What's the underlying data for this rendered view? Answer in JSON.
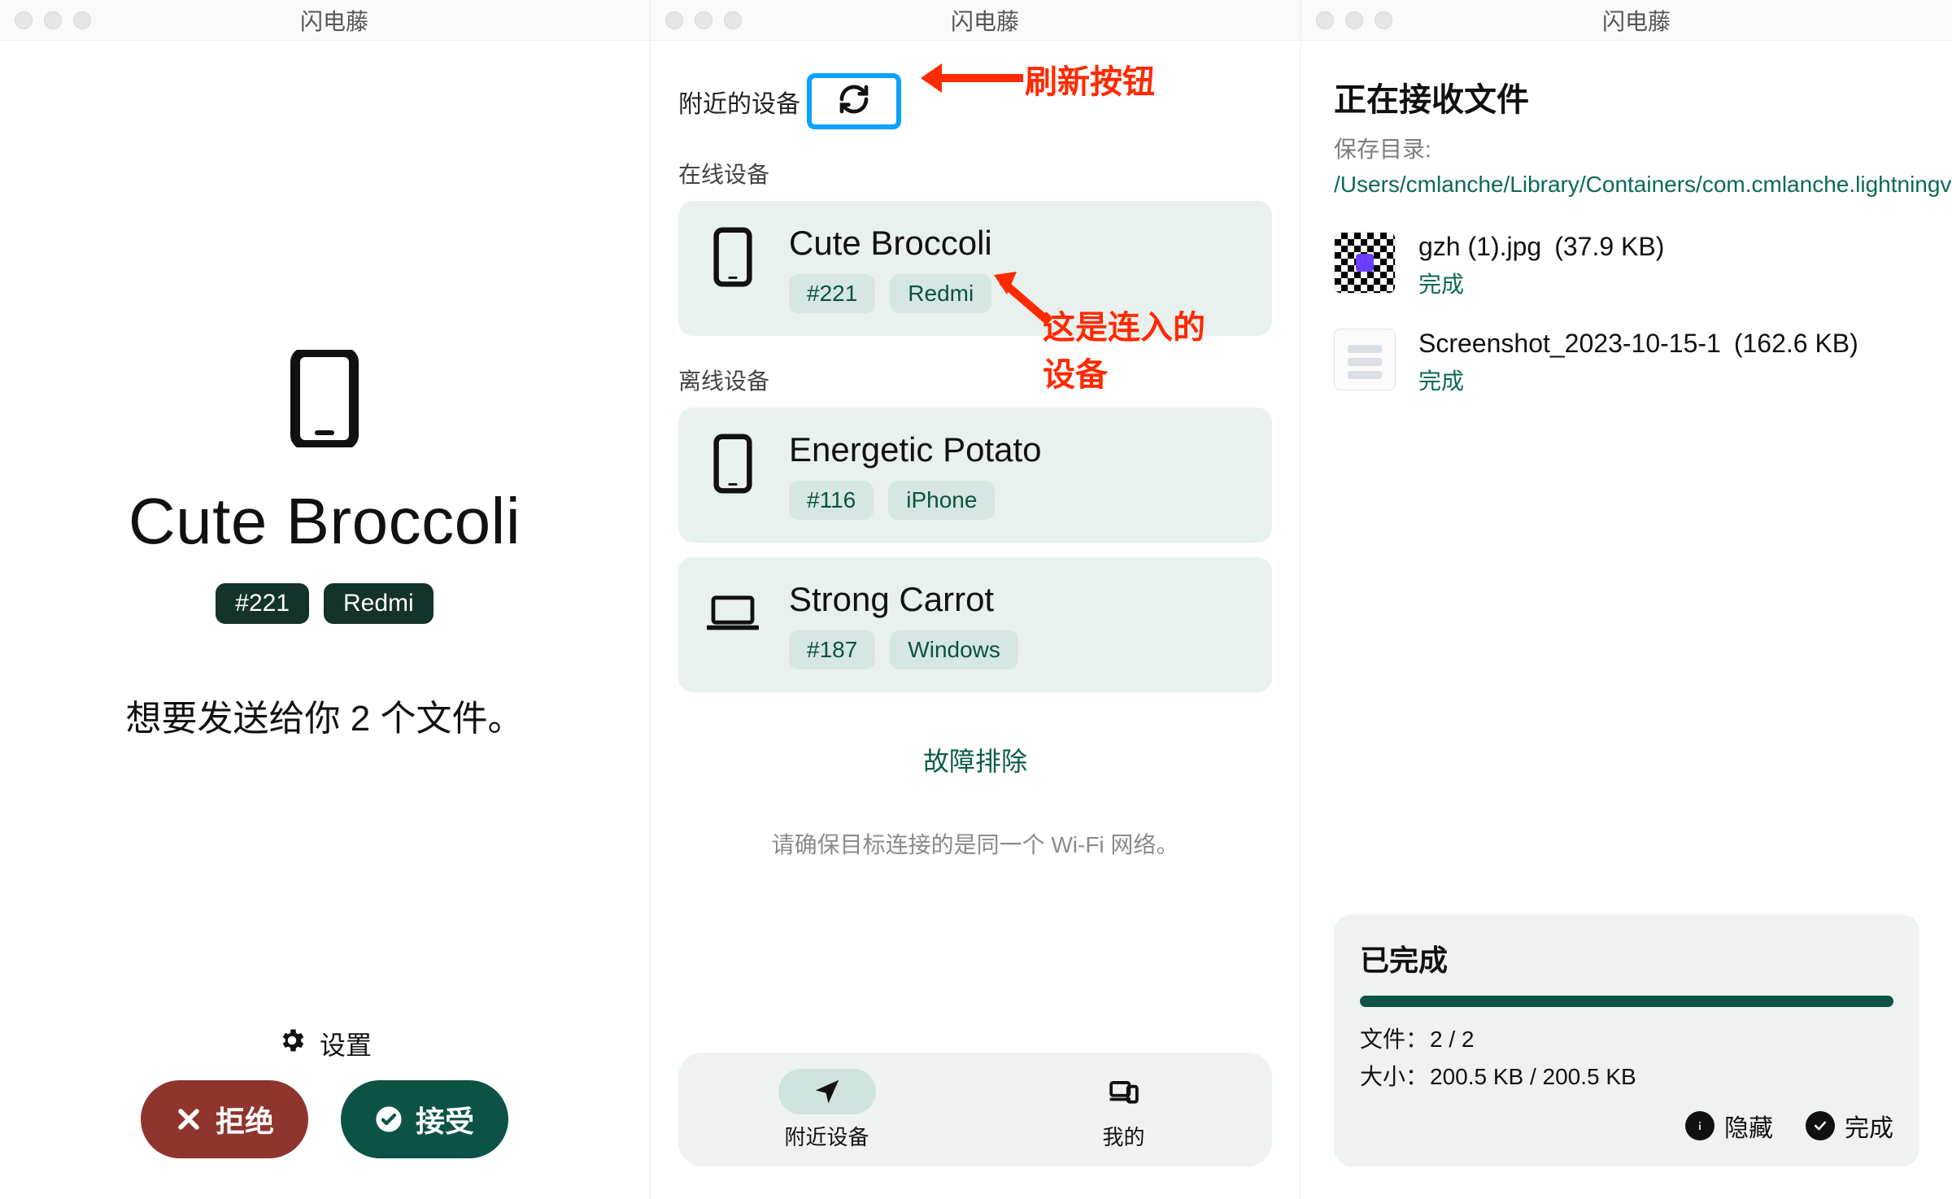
{
  "app_title": "闪电藤",
  "panel1": {
    "icon": "phone-icon",
    "device_name": "Cute Broccoli",
    "id_badge": "#221",
    "brand_badge": "Redmi",
    "message": "想要发送给你 2 个文件。",
    "settings_label": "设置",
    "decline_label": "拒绝",
    "accept_label": "接受"
  },
  "panel2": {
    "nearby_header": "附近的设备",
    "online_header": "在线设备",
    "offline_header": "离线设备",
    "annotation_refresh": "刷新按钮",
    "annotation_device_l1": "这是连入的",
    "annotation_device_l2": "设备",
    "online": [
      {
        "icon": "phone-icon",
        "name": "Cute Broccoli",
        "id": "#221",
        "brand": "Redmi"
      }
    ],
    "offline": [
      {
        "icon": "phone-icon",
        "name": "Energetic Potato",
        "id": "#116",
        "brand": "iPhone"
      },
      {
        "icon": "laptop-icon",
        "name": "Strong Carrot",
        "id": "#187",
        "brand": "Windows"
      }
    ],
    "troubleshoot": "故障排除",
    "note": "请确保目标连接的是同一个 Wi-Fi 网络。",
    "nav": {
      "nearby": "附近设备",
      "mine": "我的"
    }
  },
  "panel3": {
    "title": "正在接收文件",
    "save_dir_label": "保存目录: ",
    "save_dir_value": "/Users/cmlanche/Library/Containers/com.cmlanche.lightningvine/Data/Downloads",
    "files": [
      {
        "thumb": "qr",
        "name": "gzh (1).jpg",
        "size": "(37.9 KB)",
        "status": "完成"
      },
      {
        "thumb": "img",
        "name": "Screenshot_2023-10-15-1",
        "size": "(162.6 KB)",
        "status": "完成"
      }
    ],
    "summary": {
      "title": "已完成",
      "files_label": "文件：",
      "files_value": "2 / 2",
      "size_label": "大小：",
      "size_value": "200.5 KB / 200.5 KB",
      "hide": "隐藏",
      "done": "完成"
    }
  }
}
